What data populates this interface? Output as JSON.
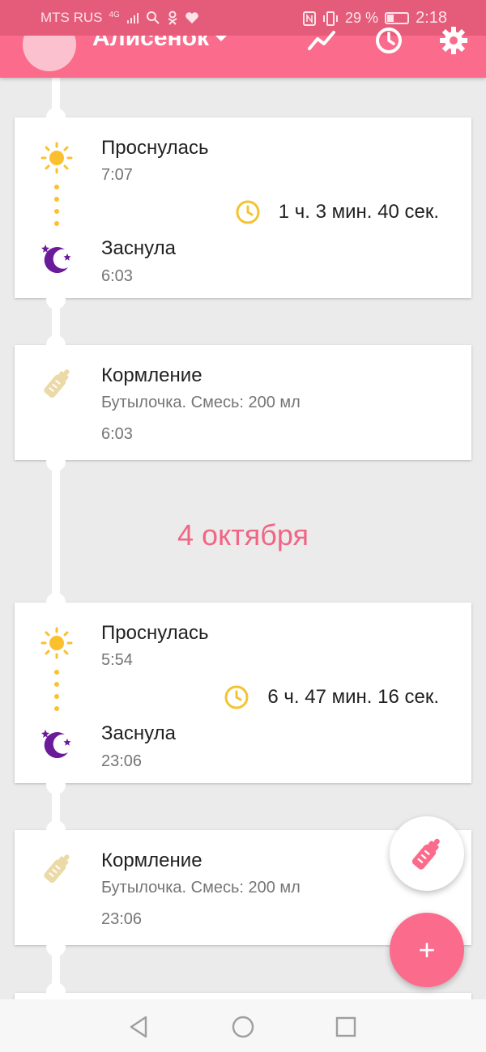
{
  "status_bar": {
    "carrier": "MTS RUS",
    "network": "4G",
    "battery_percent": "29 %",
    "time": "2:18"
  },
  "app_bar": {
    "child_name": "Алисенок",
    "icons": [
      "trend-icon",
      "clock-icon",
      "gear-icon"
    ],
    "accent_color": "#fb6b8c"
  },
  "feed": {
    "sleep_1": {
      "woke_label": "Проснулась",
      "woke_time": "7:07",
      "duration": "1 ч. 3 мин. 40 сек.",
      "slept_label": "Заснула",
      "slept_time": "6:03"
    },
    "feed_1": {
      "label": "Кормление",
      "detail": "Бутылочка. Смесь: 200 мл",
      "time": "6:03"
    },
    "date_header": "4 октября",
    "sleep_2": {
      "woke_label": "Проснулась",
      "woke_time": "5:54",
      "duration": "6 ч. 47 мин. 16 сек.",
      "slept_label": "Заснула",
      "slept_time": "23:06"
    },
    "feed_2": {
      "label": "Кормление",
      "detail": "Бутылочка. Смесь: 200 мл",
      "time": "23:06"
    }
  },
  "fabs": {
    "add_symbol": "+"
  },
  "colors": {
    "sun": "#fbc02d",
    "moon": "#6a1b9a",
    "clock": "#f4c430",
    "bottle": "#ecd9a8",
    "date_header": "#f26585"
  }
}
